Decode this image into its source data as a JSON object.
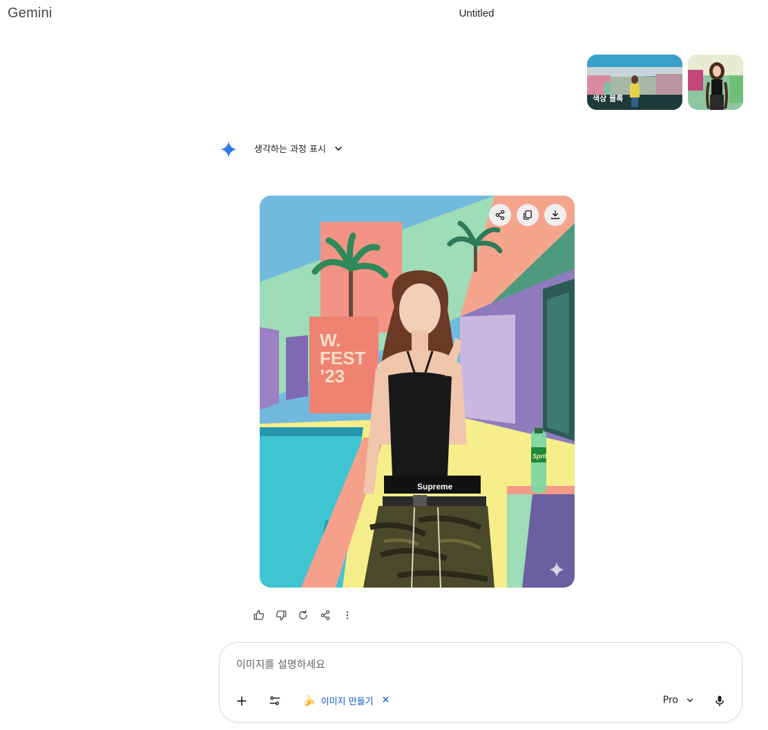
{
  "header": {
    "brand": "Gemini",
    "title": "Untitled"
  },
  "user_message": {
    "attachments": [
      {
        "caption": "색상 블록",
        "kind": "image"
      },
      {
        "caption": "",
        "kind": "image"
      }
    ]
  },
  "response": {
    "thinking_toggle_label": "생각하는 과정 표시",
    "image_text": {
      "sign_lines": [
        "W.",
        "FEST",
        "’23"
      ],
      "waistband": "Supreme",
      "bottle": "Sprite"
    },
    "image_actions": [
      "share-icon",
      "copy-icon",
      "download-icon"
    ],
    "feedback_actions": [
      "thumbs-up-icon",
      "thumbs-down-icon",
      "regenerate-icon",
      "share-icon",
      "more-vert-icon"
    ]
  },
  "composer": {
    "placeholder": "이미지를 설명하세요",
    "value": "",
    "tool_chip": {
      "emoji": "🍌",
      "label": "이미지 만들기",
      "close": "✕"
    },
    "model_label": "Pro"
  },
  "colors": {
    "accent_blue": "#0b57d0",
    "gemini_spark": "#4285f4"
  }
}
